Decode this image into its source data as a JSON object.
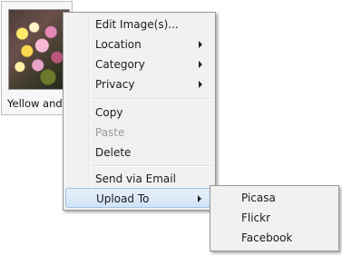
{
  "thumbnail": {
    "caption": "Yellow and "
  },
  "context_menu": {
    "items": [
      {
        "label": "Edit Image(s)..."
      },
      {
        "label": "Location"
      },
      {
        "label": "Category"
      },
      {
        "label": "Privacy"
      },
      {
        "label": "Copy"
      },
      {
        "label": "Paste"
      },
      {
        "label": "Delete"
      },
      {
        "label": "Send via Email"
      },
      {
        "label": "Upload To"
      }
    ]
  },
  "upload_submenu": {
    "items": [
      {
        "label": "Picasa"
      },
      {
        "label": "Flickr"
      },
      {
        "label": "Facebook"
      }
    ]
  },
  "colors": {
    "menu_background": "#f1f1f1",
    "highlight": "#d2e3f7",
    "disabled_text": "#9a9a9a"
  }
}
